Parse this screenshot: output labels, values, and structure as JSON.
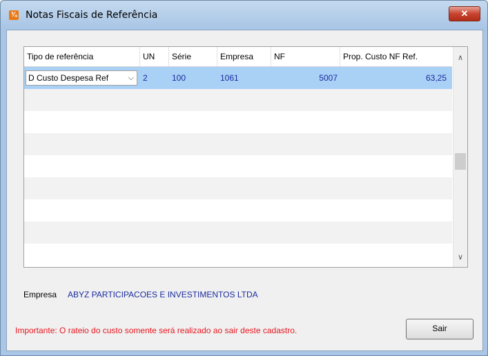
{
  "window": {
    "title": "Notas Fiscais de Referência",
    "close_glyph": "✕",
    "app_icon_glyph": "¾"
  },
  "grid": {
    "columns": [
      "Tipo de referência",
      "UN",
      "Série",
      "Empresa",
      "NF",
      "Prop. Custo NF Ref."
    ],
    "rows": [
      {
        "tipo": "D Custo Despesa Ref",
        "un": "2",
        "serie": "100",
        "empresa": "1061",
        "nf": "5007",
        "prop": "63,25"
      }
    ],
    "combo_arrow": "⌵",
    "scroll_up": "∧",
    "scroll_down": "∨"
  },
  "footer": {
    "empresa_label": "Empresa",
    "empresa_value": "ABYZ PARTICIPACOES E INVESTIMENTOS LTDA",
    "importante": "Importante: O rateio do custo somente será realizado ao sair deste cadastro.",
    "sair_label": "Sair"
  },
  "colors": {
    "selected_row": "#a9d0f5",
    "data_text": "#1a2b9e",
    "warning_text": "#e8161e",
    "close_button": "#c84430"
  },
  "icons": {
    "app": "app-logo-icon",
    "close": "close-icon",
    "dropdown": "chevron-down-icon",
    "up": "scroll-up-icon",
    "down": "scroll-down-icon"
  }
}
